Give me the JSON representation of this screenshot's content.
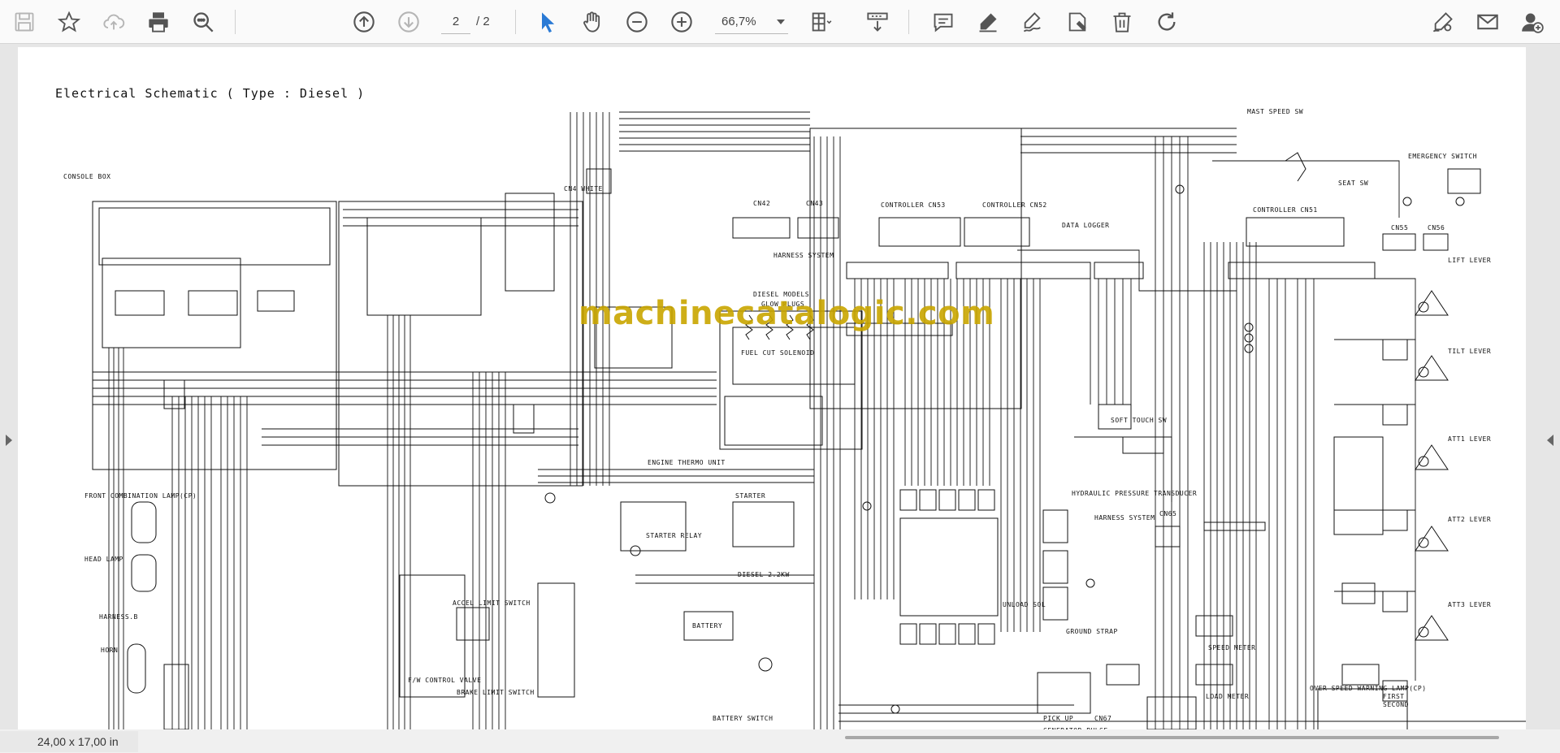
{
  "toolbar": {
    "buttons": [
      {
        "name": "save-icon",
        "disabled": true
      },
      {
        "name": "bookmark-star-icon"
      },
      {
        "name": "upload-cloud-icon",
        "disabled": true
      },
      {
        "name": "print-icon"
      },
      {
        "name": "zoom-search-icon"
      },
      {
        "name": "page-up-icon"
      },
      {
        "name": "page-down-icon",
        "disabled": true
      },
      {
        "name": "select-cursor-icon",
        "active": true
      },
      {
        "name": "hand-pan-icon"
      },
      {
        "name": "zoom-out-icon"
      },
      {
        "name": "zoom-in-icon"
      },
      {
        "name": "fit-page-icon"
      },
      {
        "name": "scroll-mode-icon"
      },
      {
        "name": "comment-icon"
      },
      {
        "name": "highlight-pen-icon"
      },
      {
        "name": "draw-sign-icon"
      },
      {
        "name": "stamp-icon"
      },
      {
        "name": "delete-trash-icon"
      },
      {
        "name": "rotate-icon"
      },
      {
        "name": "fill-sign-icon"
      },
      {
        "name": "email-icon"
      },
      {
        "name": "add-user-icon"
      }
    ],
    "page_current": "2",
    "page_total": "/ 2",
    "zoom": "66,7%"
  },
  "colors": {
    "accent": "#2a7ad5",
    "icon": "#555555",
    "icon_disabled": "#b5b5b5",
    "watermark": "#c9a600",
    "ink": "#111111"
  },
  "document": {
    "title": "Electrical Schematic ( Type : Diesel )",
    "watermark": "machinecatalogic.com",
    "labels": {
      "console_box": "CONSOLE BOX",
      "cn4_white": "CN4 WHITE",
      "cn42": "CN42",
      "cn43": "CN43",
      "controller_cn53": "CONTROLLER CN53",
      "controller_cn52": "CONTROLLER CN52",
      "controller_cn51": "CONTROLLER CN51",
      "data_logger": "DATA LOGGER",
      "mast_speed_sw": "MAST SPEED SW",
      "emergency_switch": "EMERGENCY SWITCH",
      "seat_sw": "SEAT SW",
      "harness_system": "HARNESS SYSTEM",
      "diesel_models": "DIESEL MODELS",
      "glow_plugs": "GLOW PLUGS",
      "fuel_cut_solenoid": "FUEL CUT SOLENOID",
      "lift_lever": "LIFT LEVER",
      "tilt_lever": "TILT LEVER",
      "att1_lever": "ATT1 LEVER",
      "att2_lever": "ATT2 LEVER",
      "att3_lever": "ATT3 LEVER",
      "front_combination_lamp": "FRONT COMBINATION LAMP(CP)",
      "head_lamp": "HEAD LAMP",
      "harness_b": "HARNESS.B",
      "horn": "HORN",
      "engine_thermo_unit": "ENGINE THERMO UNIT",
      "starter": "STARTER",
      "starter_relay": "STARTER RELAY",
      "diesel_kw": "DIESEL 2.2KW",
      "battery": "BATTERY",
      "battery_switch": "BATTERY SWITCH",
      "hydraulic_pressure_transducer": "HYDRAULIC PRESSURE TRANSDUCER",
      "harness_system_2": "HARNESS SYSTEM",
      "cn55": "CN55",
      "cn56": "CN56",
      "cn65": "CN65",
      "unload_sol": "UNLOAD SOL",
      "ground_strap": "GROUND STRAP",
      "pick_up": "PICK UP",
      "cn67": "CN67",
      "generator_pulse": "GENERATOR PULSE",
      "over_speed_warning_lamp": "OVER SPEED WARNING LAMP(CP)",
      "first": "FIRST",
      "second": "SECOND",
      "speed_meter": "SPEED METER",
      "load_meter": "LOAD METER",
      "fw_control_valve": "F/W CONTROL VALVE",
      "accel_limit_switch": "ACCEL LIMIT SWITCH",
      "brake_limit_switch": "BRAKE LIMIT SWITCH",
      "soft touch sw": "SOFT TOUCH SW"
    }
  },
  "status": {
    "page_size": "24,00 x 17,00 in"
  }
}
